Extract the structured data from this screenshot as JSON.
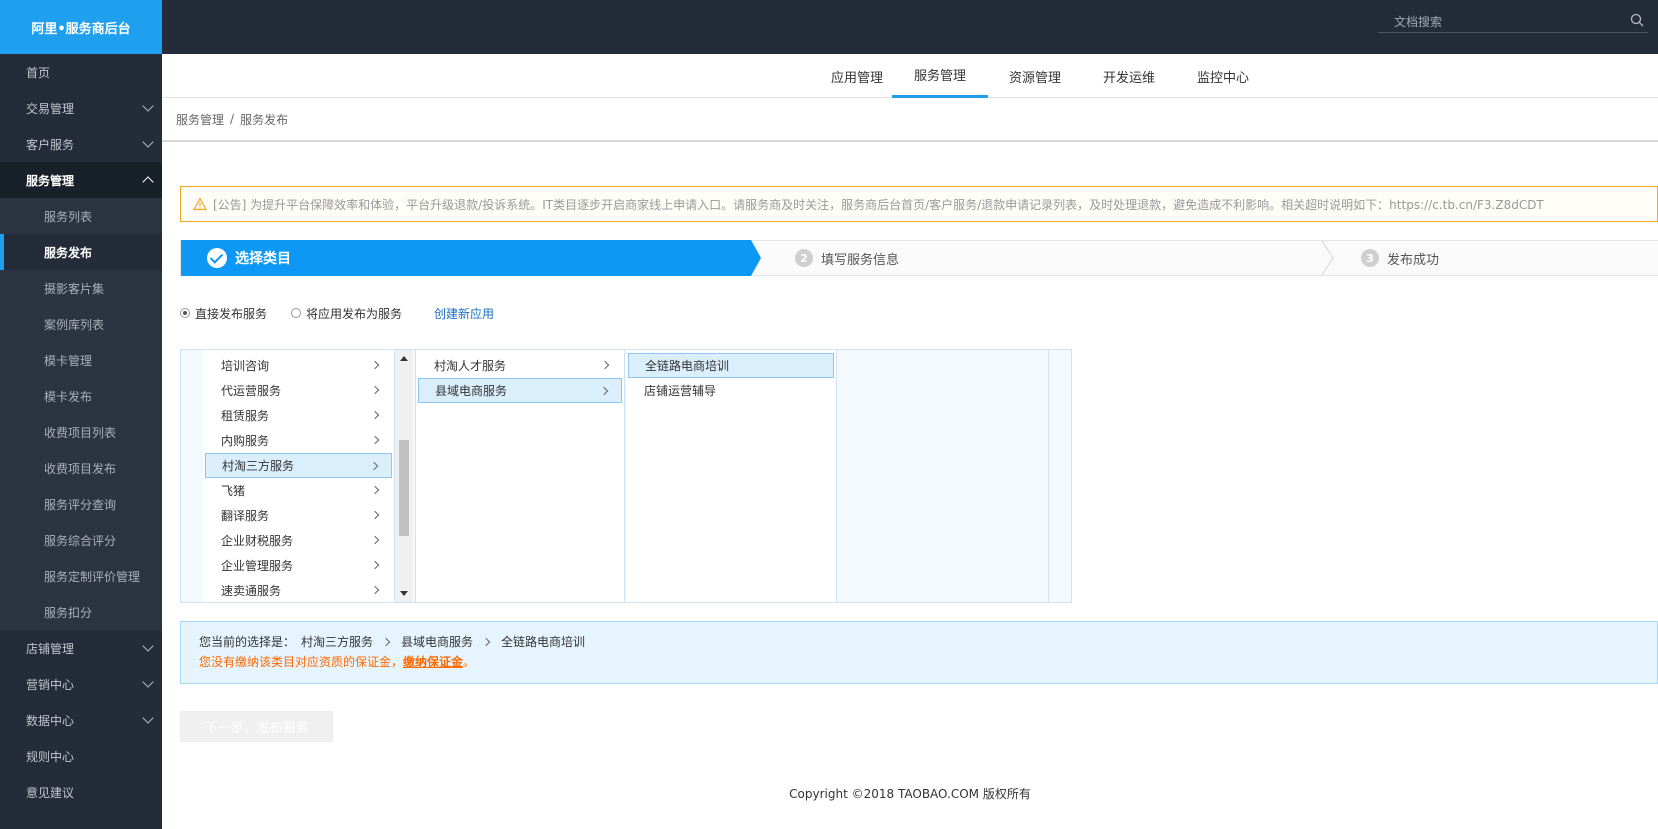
{
  "sidebar": {
    "logo": "阿里•服务商后台",
    "items": [
      {
        "label": "首页"
      },
      {
        "label": "交易管理"
      },
      {
        "label": "客户服务"
      },
      {
        "label": "服务管理"
      }
    ],
    "sub_items": [
      {
        "label": "服务列表"
      },
      {
        "label": "服务发布"
      },
      {
        "label": "摄影客片集"
      },
      {
        "label": "案例库列表"
      },
      {
        "label": "模卡管理"
      },
      {
        "label": "模卡发布"
      },
      {
        "label": "收费项目列表"
      },
      {
        "label": "收费项目发布"
      },
      {
        "label": "服务评分查询"
      },
      {
        "label": "服务综合评分"
      },
      {
        "label": "服务定制评价管理"
      },
      {
        "label": "服务扣分"
      }
    ],
    "items_after": [
      {
        "label": "店铺管理"
      },
      {
        "label": "营销中心"
      },
      {
        "label": "数据中心"
      },
      {
        "label": "规则中心"
      },
      {
        "label": "意见建议"
      }
    ]
  },
  "header": {
    "search_placeholder": "文档搜索"
  },
  "tabs": [
    {
      "label": "应用管理"
    },
    {
      "label": "服务管理"
    },
    {
      "label": "资源管理"
    },
    {
      "label": "开发运维"
    },
    {
      "label": "监控中心"
    }
  ],
  "breadcrumb": {
    "parent": "服务管理",
    "separator": "/",
    "current": "服务发布"
  },
  "notice": "[公告] 为提升平台保障效率和体验，平台升级退款/投诉系统。IT类目逐步开启商家线上申请入口。请服务商及时关注，服务商后台首页/客户服务/退款申请记录列表，及时处理退款，避免造成不利影响。相关超时说明如下：https://c.tb.cn/F3.Z8dCDT",
  "steps": [
    {
      "label": "选择类目"
    },
    {
      "num": "2",
      "label": "填写服务信息"
    },
    {
      "num": "3",
      "label": "发布成功"
    }
  ],
  "publish_mode": {
    "option_direct": "直接发布服务",
    "option_app": "将应用发布为服务",
    "create_link": "创建新应用"
  },
  "categories": {
    "level1": [
      "培训咨询",
      "代运营服务",
      "租赁服务",
      "内购服务",
      "村淘三方服务",
      "飞猪",
      "翻译服务",
      "企业财税服务",
      "企业管理服务",
      "速卖通服务"
    ],
    "level2": [
      "村淘人才服务",
      "县域电商服务"
    ],
    "level3": [
      "全链路电商培训",
      "店铺运营辅导"
    ]
  },
  "current_selection": {
    "prefix": "您当前的选择是：",
    "path": [
      "村淘三方服务",
      "县域电商服务",
      "全链路电商培训"
    ],
    "warning_text": "您没有缴纳该类目对应资质的保证金，",
    "warning_link": "缴纳保证金",
    "warning_end": "。"
  },
  "next_button": "下一步，发布服务",
  "footer": "Copyright ©2018 TAOBAO.COM 版权所有",
  "colors": {
    "sidebar": "#232c38",
    "accent": "#1ea0ee",
    "warning": "#ff6a00"
  }
}
